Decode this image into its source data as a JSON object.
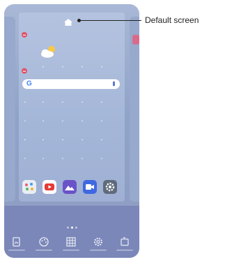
{
  "callout": {
    "label": "Default screen"
  },
  "search": {
    "logo_letter": "G"
  },
  "dock": {
    "apps": [
      {
        "name": "gallery-app-icon",
        "color": "#e9edf4"
      },
      {
        "name": "youtube-app-icon",
        "color": "#e53935"
      },
      {
        "name": "photos-app-icon",
        "color": "#6a52c8"
      },
      {
        "name": "video-app-icon",
        "color": "#3f68e0"
      },
      {
        "name": "settings-app-icon",
        "color": "#5f6b7a"
      }
    ]
  },
  "toolbar": {
    "items": [
      {
        "icon": "wallpaper-icon"
      },
      {
        "icon": "theme-icon"
      },
      {
        "icon": "grid-icon"
      },
      {
        "icon": "settings-icon"
      },
      {
        "icon": "rotate-icon"
      }
    ]
  }
}
